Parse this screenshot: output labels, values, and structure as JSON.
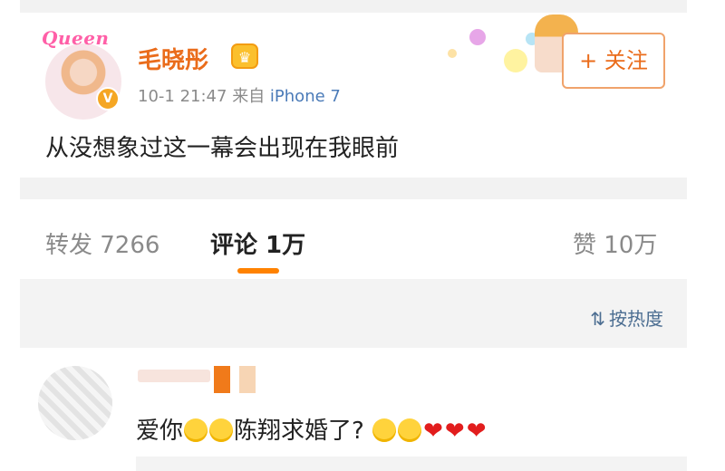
{
  "post": {
    "avatar_label": "Queen",
    "author": "毛晓彤",
    "time": "10-1 21:47",
    "from_label": "来自",
    "device": "iPhone 7",
    "follow_label": "+ 关注",
    "text": "从没想象过这一幕会出现在我眼前"
  },
  "tabs": {
    "repost": "转发 7266",
    "comments": "评论 1万",
    "likes": "赞 10万"
  },
  "sort": {
    "icon": "sort-icon",
    "label": "按热度"
  },
  "comment": {
    "text_part1": "爱你",
    "text_part2": "陈翔求婚了?",
    "emoji_icon": "smile-emoji",
    "heart_icon": "heart"
  },
  "colors": {
    "accent": "#ff8200",
    "username": "#ea6c1b",
    "link": "#4b6d91",
    "heart": "#e21d1d"
  }
}
